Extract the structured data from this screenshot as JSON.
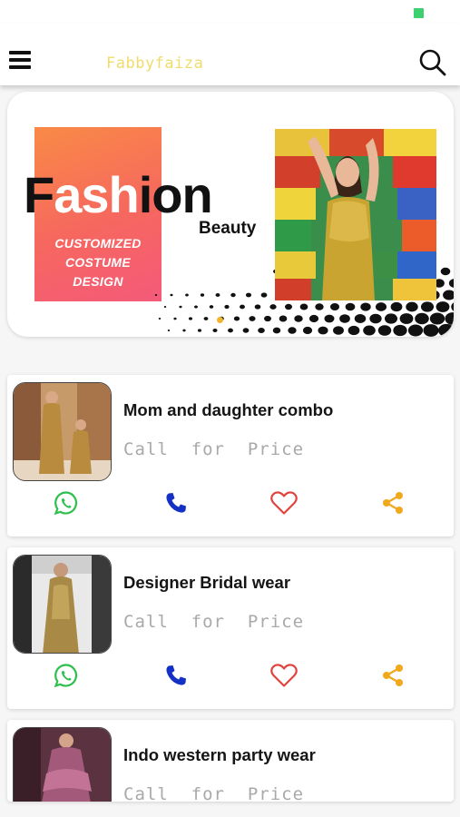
{
  "app": {
    "title": "Fabbyfaiza"
  },
  "colors": {
    "accent": "#f2b52c",
    "whatsapp": "#2fbf4f",
    "call": "#1530c4",
    "favorite": "#e0433c",
    "share": "#f0a81d",
    "title": "#f0dc6a"
  },
  "banner": {
    "headline_parts": [
      "F",
      "ash",
      "ion"
    ],
    "subheadline": "Beauty",
    "badge_lines": [
      "CUSTOMIZED",
      "COSTUME",
      "DESIGN"
    ]
  },
  "products": [
    {
      "title": "Mom and daughter combo",
      "price_text": "Call  for  Price",
      "thumb": "gold-dress-duo"
    },
    {
      "title": "Designer Bridal wear",
      "price_text": "Call  for  Price",
      "thumb": "golden-gown"
    },
    {
      "title": "Indo western party wear",
      "price_text": "Call  for  Price",
      "thumb": "purple-ruffle-dress"
    }
  ],
  "icons": {
    "menu": "hamburger-icon",
    "search": "search-icon",
    "whatsapp": "whatsapp-icon",
    "call": "phone-icon",
    "favorite": "heart-icon",
    "share": "share-icon"
  }
}
